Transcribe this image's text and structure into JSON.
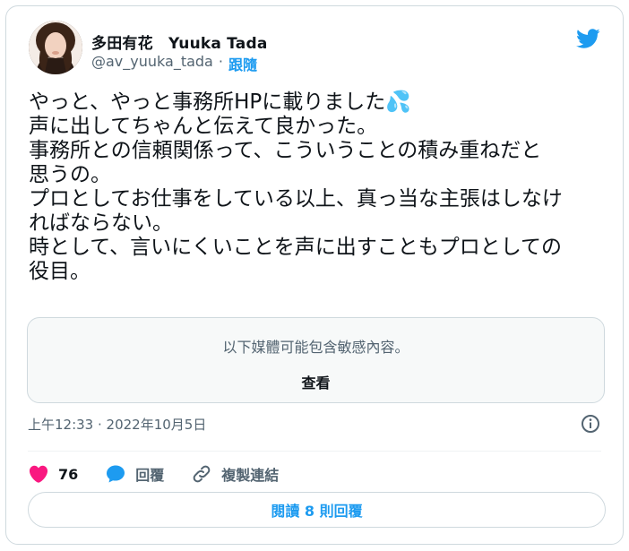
{
  "author": {
    "display_name": "多田有花　Yuuka Tada",
    "handle": "@av_yuuka_tada",
    "separator": "·",
    "follow_label": "跟隨",
    "avatar_icon": "profile-photo"
  },
  "brand": {
    "logo_icon": "twitter-bird-icon",
    "color": "#1d9bf0"
  },
  "tweet": {
    "text": "やっと、やっと事務所HPに載りました💦\n声に出してちゃんと伝えて良かった。\n事務所との信頼関係って、こういうことの積み重ねだと\n思うの。\nプロとしてお仕事をしている以上、真っ当な主張はしなけ\nればならない。\n時として、言いにくいことを声に出すこともプロとしての\n役目。"
  },
  "sensitive_media": {
    "notice": "以下媒體可能包含敏感內容。",
    "view_label": "查看"
  },
  "timestamp": "上午12:33 · 2022年10月5日",
  "actions": {
    "like_count": "76",
    "reply_label": "回覆",
    "copy_link_label": "複製連結",
    "like_color": "#f91880"
  },
  "read_replies_label": "閱讀 8 則回覆"
}
